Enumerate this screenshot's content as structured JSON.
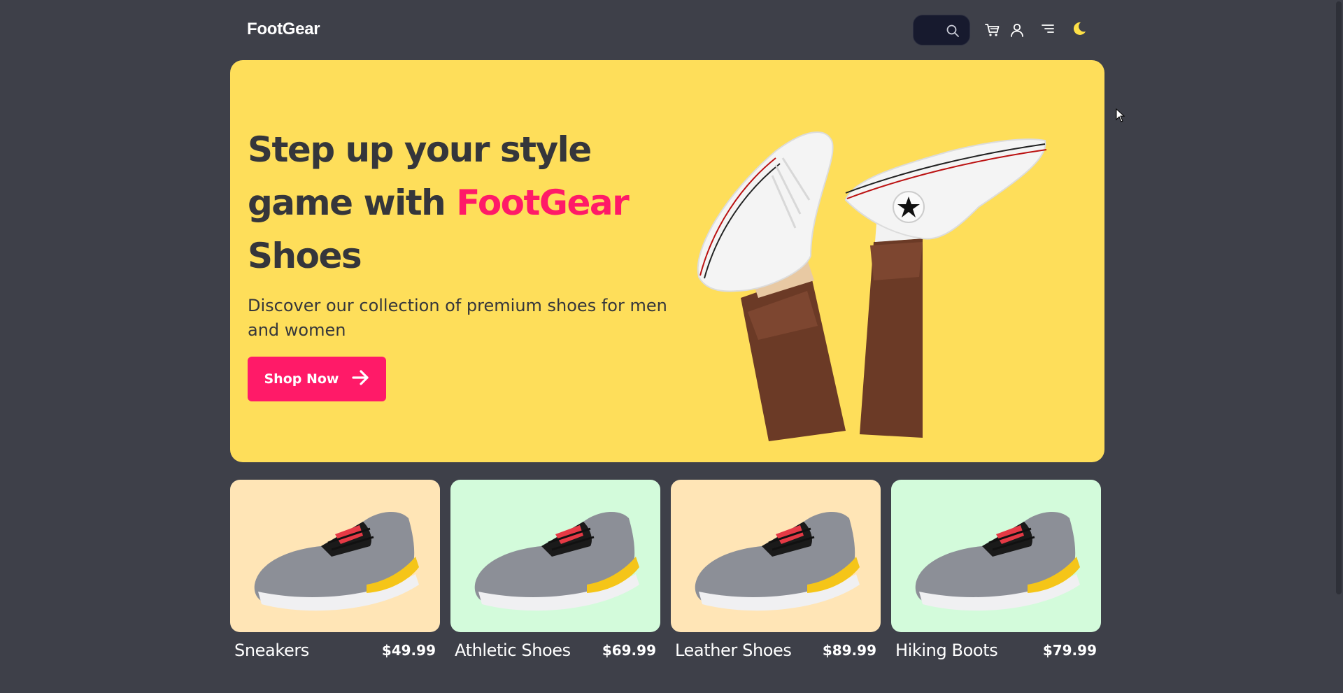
{
  "header": {
    "brand": "FootGear",
    "search_placeholder": "",
    "icons": [
      "search-icon",
      "cart-icon",
      "user-icon",
      "menu-icon",
      "moon-icon"
    ]
  },
  "hero": {
    "title_line1": "Step up your style",
    "title_line2_prefix": "game with ",
    "title_accent": "FootGear",
    "title_line3": "Shoes",
    "subtitle": "Discover our collection of premium shoes for men and women",
    "cta_label": "Shop Now",
    "cta_icon": "arrow-right-icon"
  },
  "products": [
    {
      "name": "Sneakers",
      "price": "$49.99",
      "bg": "#ffe5b6"
    },
    {
      "name": "Athletic Shoes",
      "price": "$69.99",
      "bg": "#d3fbdb"
    },
    {
      "name": "Leather Shoes",
      "price": "$89.99",
      "bg": "#ffe5b6"
    },
    {
      "name": "Hiking Boots",
      "price": "$79.99",
      "bg": "#d3fbdb"
    }
  ],
  "colors": {
    "page_bg": "#3e4049",
    "hero_bg": "#fede5a",
    "accent": "#ff1a68",
    "text_dark": "#35363b",
    "moon": "#fde047"
  }
}
